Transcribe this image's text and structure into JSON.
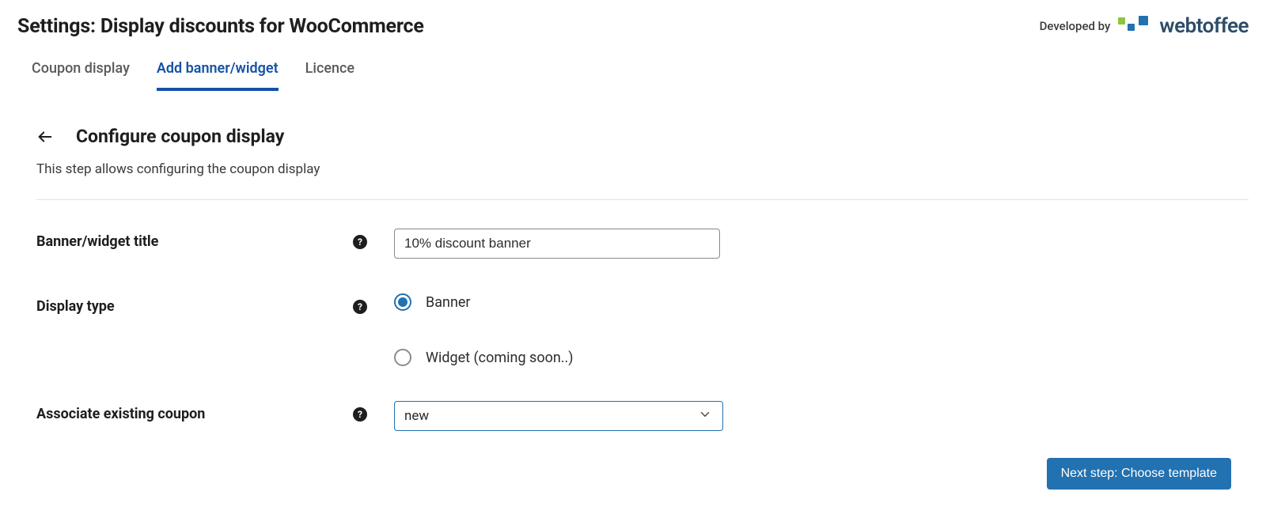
{
  "header": {
    "title": "Settings: Display discounts for WooCommerce",
    "developed_by": "Developed by",
    "brand": "webtoffee"
  },
  "tabs": [
    {
      "label": "Coupon display",
      "active": false
    },
    {
      "label": "Add banner/widget",
      "active": true
    },
    {
      "label": "Licence",
      "active": false
    }
  ],
  "section": {
    "title": "Configure coupon display",
    "description": "This step allows configuring the coupon display"
  },
  "form": {
    "title_label": "Banner/widget title",
    "title_value": "10% discount banner",
    "display_type_label": "Display type",
    "display_type_options": [
      {
        "label": "Banner",
        "checked": true
      },
      {
        "label": "Widget (coming soon..)",
        "checked": false
      }
    ],
    "associate_label": "Associate existing coupon",
    "associate_value": "new"
  },
  "footer": {
    "next_label": "Next step: Choose template"
  },
  "help_glyph": "?"
}
